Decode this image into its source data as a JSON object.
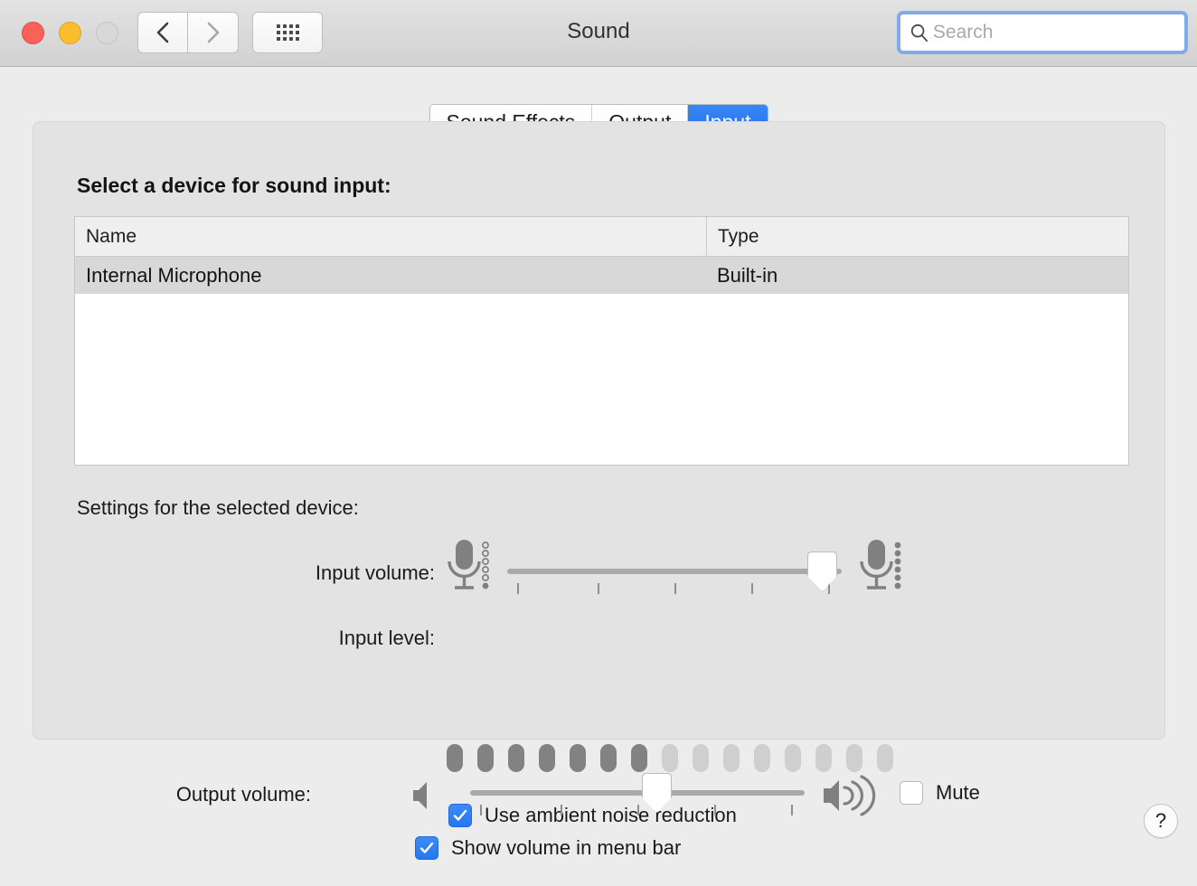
{
  "window": {
    "title": "Sound",
    "traffic_lights": [
      "close",
      "minimize",
      "zoom"
    ],
    "nav": {
      "back": "back-chevron",
      "forward": "forward-chevron",
      "grid": "show-all-grid"
    },
    "search": {
      "placeholder": "Search",
      "value": "",
      "icon": "search-icon"
    }
  },
  "tabs": [
    {
      "label": "Sound Effects",
      "active": false
    },
    {
      "label": "Output",
      "active": false
    },
    {
      "label": "Input",
      "active": true
    }
  ],
  "panel": {
    "heading": "Select a device for sound input:",
    "table": {
      "columns": [
        "Name",
        "Type"
      ],
      "rows": [
        {
          "name": "Internal Microphone",
          "type": "Built-in",
          "selected": true
        }
      ]
    },
    "settings_label": "Settings for the selected device:",
    "input_volume": {
      "label": "Input volume:",
      "value_percent": 97,
      "tick_count": 5,
      "icon_low": "microphone-quiet-icon",
      "icon_high": "microphone-loud-icon"
    },
    "input_level": {
      "label": "Input level:",
      "segments_total": 15,
      "segments_active": 7
    },
    "ambient_noise": {
      "label": "Use ambient noise reduction",
      "checked": true
    },
    "help": {
      "label": "?"
    }
  },
  "output": {
    "label": "Output volume:",
    "value_percent": 53,
    "tick_count": 5,
    "icon_low": "speaker-mute-icon",
    "icon_high": "speaker-loud-icon",
    "mute": {
      "label": "Mute",
      "checked": false
    },
    "show_volume": {
      "label": "Show volume in menu bar",
      "checked": true
    }
  },
  "colors": {
    "accent_blue": "#2577ef",
    "tab_active_blue": "#2f7cf0",
    "search_focus_ring": "#81aceb",
    "panel_bg": "#e3e3e3",
    "page_bg": "#ececec",
    "selected_row": "#d8d8d8",
    "meter_on": "#828282",
    "meter_off": "#cfcfcf"
  }
}
